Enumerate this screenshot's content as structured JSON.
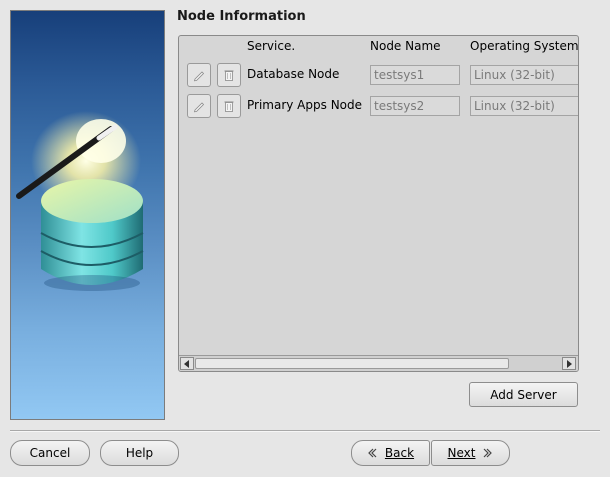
{
  "section": {
    "title": "Node Information"
  },
  "grid": {
    "headers": {
      "service": "Service.",
      "node_name": "Node Name",
      "os": "Operating System"
    },
    "rows": [
      {
        "service": "Database Node",
        "node_name": "testsys1",
        "os": "Linux (32-bit)"
      },
      {
        "service": "Primary Apps Node",
        "node_name": "testsys2",
        "os": "Linux (32-bit)"
      }
    ]
  },
  "buttons": {
    "add_server": "Add Server",
    "cancel": "Cancel",
    "help": "Help",
    "back": "Back",
    "next": "Next"
  },
  "icons": {
    "edit": "edit-icon",
    "delete": "trash-icon",
    "back": "chevron-left-icon",
    "next": "chevron-right-icon"
  },
  "colors": {
    "window_bg": "#e6e6e6",
    "banner_top": "#173f7a",
    "banner_bottom": "#92c8f3",
    "database_teal": "#4fc9c9"
  }
}
